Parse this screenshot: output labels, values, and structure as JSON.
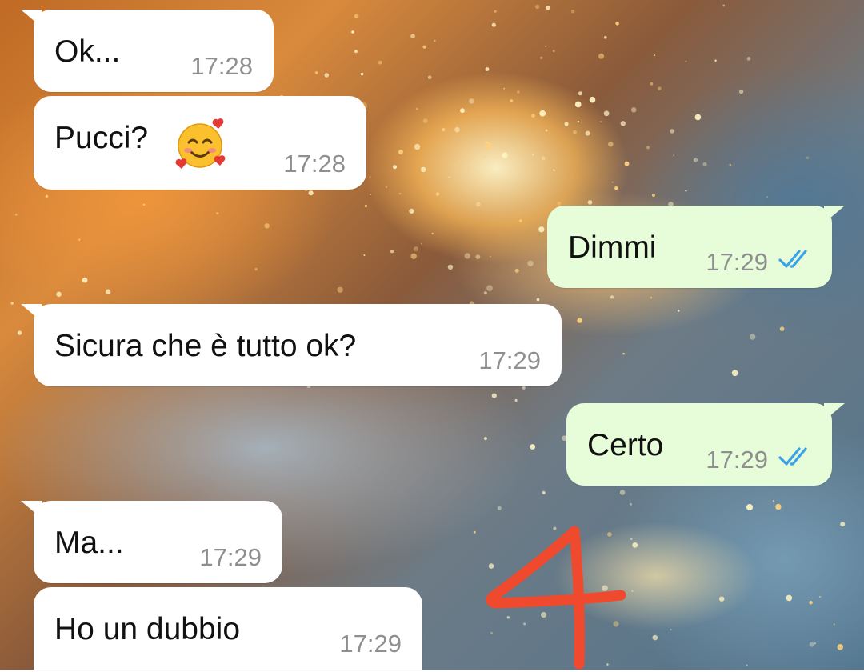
{
  "conversation": {
    "messages": [
      {
        "direction": "incoming",
        "text": "Ok...",
        "time": "17:28"
      },
      {
        "direction": "incoming",
        "text": "Pucci?",
        "emoji": "smiling-face-with-hearts",
        "time": "17:28"
      },
      {
        "direction": "outgoing",
        "text": "Dimmi",
        "time": "17:29",
        "status": "read"
      },
      {
        "direction": "incoming",
        "text": "Sicura che è tutto ok?",
        "time": "17:29"
      },
      {
        "direction": "outgoing",
        "text": "Certo",
        "time": "17:29",
        "status": "read"
      },
      {
        "direction": "incoming",
        "text": "Ma...",
        "time": "17:29"
      },
      {
        "direction": "incoming",
        "text": "Ho un dubbio",
        "time": "17:29"
      }
    ]
  },
  "annotation": {
    "text": "4",
    "color": "#f04a2e"
  },
  "colors": {
    "incoming_bubble": "#ffffff",
    "outgoing_bubble": "#e7fcd8",
    "read_ticks": "#3aa3e8",
    "timestamp": "#8f8f8f"
  }
}
